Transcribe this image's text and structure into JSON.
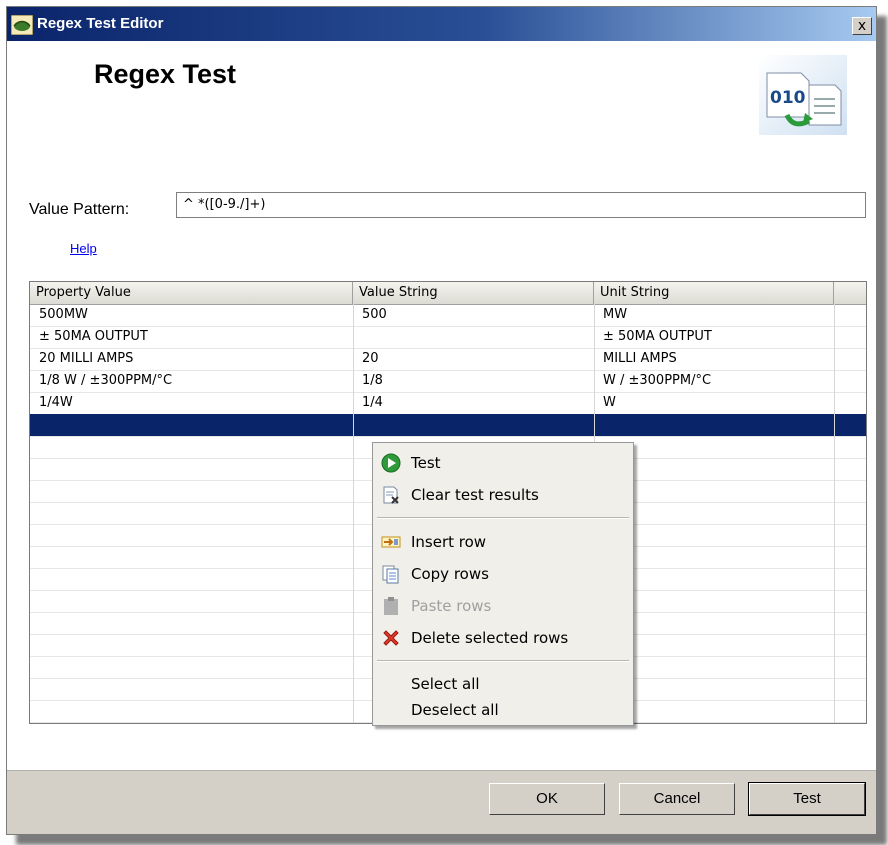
{
  "window": {
    "title": "Regex Test Editor",
    "close_label": "x"
  },
  "header": {
    "title": "Regex Test"
  },
  "pattern": {
    "label": "Value Pattern:",
    "value": "^ *([0-9./]+)"
  },
  "help": {
    "label": "Help"
  },
  "table": {
    "columns": [
      "Property Value",
      "Value String",
      "Unit String"
    ],
    "rows": [
      [
        "500MW",
        "500",
        "MW"
      ],
      [
        "± 50MA OUTPUT",
        "",
        "± 50MA OUTPUT"
      ],
      [
        "20 MILLI AMPS",
        "20",
        "MILLI AMPS"
      ],
      [
        "1/8 W / ±300PPM/°C",
        "1/8",
        "W / ±300PPM/°C"
      ],
      [
        "1/4W",
        "1/4",
        "W"
      ]
    ]
  },
  "context_menu": {
    "items": [
      {
        "label": "Test",
        "icon": "play-icon"
      },
      {
        "label": "Clear test results",
        "icon": "clear-icon"
      },
      {
        "label": "Insert row",
        "icon": "insert-row-icon"
      },
      {
        "label": "Copy rows",
        "icon": "copy-icon"
      },
      {
        "label": "Paste rows",
        "icon": "paste-icon",
        "disabled": true
      },
      {
        "label": "Delete selected rows",
        "icon": "delete-icon"
      },
      {
        "label": "Select all"
      },
      {
        "label": "Deselect all"
      }
    ]
  },
  "footer": {
    "ok": "OK",
    "cancel": "Cancel",
    "test": "Test"
  },
  "colors": {
    "selection": "#0a246a",
    "titlebar": "#0a246a",
    "footer": "#d4d0c8"
  }
}
